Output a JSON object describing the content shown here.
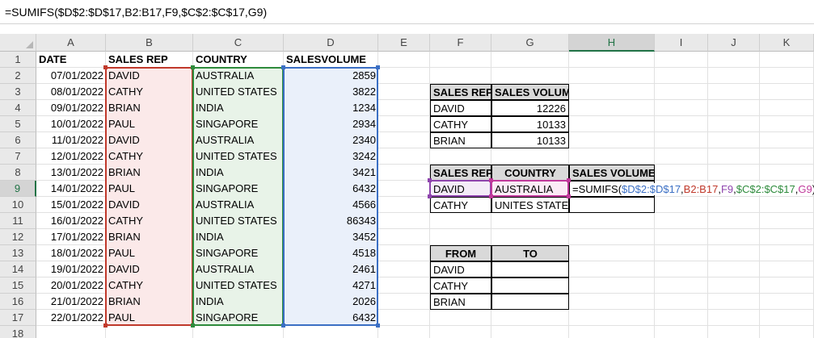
{
  "formula_bar": {
    "text": "=SUMIFS($D$2:$D$17,B2:B17,F9,$C$2:$C$17,G9)"
  },
  "columns": [
    "A",
    "B",
    "C",
    "D",
    "E",
    "F",
    "G",
    "H",
    "I",
    "J",
    "K"
  ],
  "rows": [
    "1",
    "2",
    "3",
    "4",
    "5",
    "6",
    "7",
    "8",
    "9",
    "10",
    "11",
    "12",
    "13",
    "14",
    "15",
    "16",
    "17",
    "18"
  ],
  "headers": {
    "date": "DATE",
    "sales_rep": "SALES REP",
    "country": "COUNTRY",
    "sales_volume": "SALESVOLUME"
  },
  "data": [
    {
      "date": "07/01/2022",
      "rep": "DAVID",
      "country": "AUSTRALIA",
      "volume": "2859"
    },
    {
      "date": "08/01/2022",
      "rep": "CATHY",
      "country": "UNITED STATES",
      "volume": "3822"
    },
    {
      "date": "09/01/2022",
      "rep": "BRIAN",
      "country": "INDIA",
      "volume": "1234"
    },
    {
      "date": "10/01/2022",
      "rep": "PAUL",
      "country": "SINGAPORE",
      "volume": "2934"
    },
    {
      "date": "11/01/2022",
      "rep": "DAVID",
      "country": "AUSTRALIA",
      "volume": "2340"
    },
    {
      "date": "12/01/2022",
      "rep": "CATHY",
      "country": "UNITED STATES",
      "volume": "3242"
    },
    {
      "date": "13/01/2022",
      "rep": "BRIAN",
      "country": "INDIA",
      "volume": "3421"
    },
    {
      "date": "14/01/2022",
      "rep": "PAUL",
      "country": "SINGAPORE",
      "volume": "6432"
    },
    {
      "date": "15/01/2022",
      "rep": "DAVID",
      "country": "AUSTRALIA",
      "volume": "4566"
    },
    {
      "date": "16/01/2022",
      "rep": "CATHY",
      "country": "UNITED STATES",
      "volume": "86343"
    },
    {
      "date": "17/01/2022",
      "rep": "BRIAN",
      "country": "INDIA",
      "volume": "3452"
    },
    {
      "date": "18/01/2022",
      "rep": "PAUL",
      "country": "SINGAPORE",
      "volume": "4518"
    },
    {
      "date": "19/01/2022",
      "rep": "DAVID",
      "country": "AUSTRALIA",
      "volume": "2461"
    },
    {
      "date": "20/01/2022",
      "rep": "CATHY",
      "country": "UNITED STATES",
      "volume": "4271"
    },
    {
      "date": "21/01/2022",
      "rep": "BRIAN",
      "country": "INDIA",
      "volume": "2026"
    },
    {
      "date": "22/01/2022",
      "rep": "PAUL",
      "country": "SINGAPORE",
      "volume": "6432"
    }
  ],
  "summary1": {
    "h_rep": "SALES REP",
    "h_vol": "SALES VOLUME",
    "rows": [
      {
        "rep": "DAVID",
        "vol": "12226"
      },
      {
        "rep": "CATHY",
        "vol": "10133"
      },
      {
        "rep": "BRIAN",
        "vol": "10133"
      }
    ]
  },
  "summary2": {
    "h_rep": "SALES REP",
    "h_country": "COUNTRY",
    "h_vol": "SALES VOLUME",
    "r1_rep": "DAVID",
    "r1_country": "AUSTRALIA",
    "r2_rep": "CATHY",
    "r2_country": "UNITES STATES",
    "editing_formula": {
      "p0": "=SUMIFS(",
      "p1": "$D$2:$D$17",
      "p2": ",",
      "p3": "B2:B17",
      "p4": ",",
      "p5": "F9",
      "p6": ",",
      "p7": "$C$2:$C$17",
      "p8": ",",
      "p9": "G9",
      "p10": ")"
    }
  },
  "summary3": {
    "h_from": "FROM",
    "h_to": "TO",
    "rows": [
      "DAVID",
      "CATHY",
      "BRIAN"
    ]
  },
  "colors": {
    "range_red": "#c0392b",
    "range_green": "#2e8b3c",
    "range_blue": "#3b6fc4",
    "range_purple": "#8e44ad",
    "range_magenta": "#c0399b",
    "excel_green": "#217346"
  }
}
